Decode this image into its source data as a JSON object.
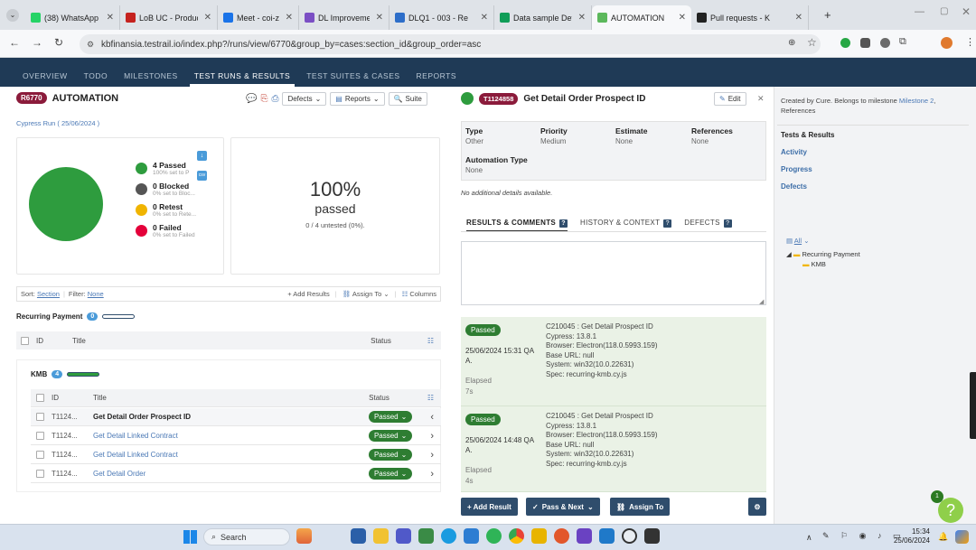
{
  "browser": {
    "tabs": [
      {
        "label": "(38) WhatsApp",
        "color": "#25d366"
      },
      {
        "label": "LoB UC - Produc",
        "color": "#c5221f"
      },
      {
        "label": "Meet - coi-z",
        "color": "#1a73e8"
      },
      {
        "label": "DL Improvement",
        "color": "#7b4fc4"
      },
      {
        "label": "DLQ1 - 003 - Re",
        "color": "#2d6ec9"
      },
      {
        "label": "Data sample Det",
        "color": "#0f9d58"
      },
      {
        "label": "AUTOMATION",
        "color": "#5cb85c"
      },
      {
        "label": "Pull requests - K",
        "color": "#222222"
      }
    ],
    "url": "kbfinansia.testrail.io/index.php?/runs/view/6770&group_by=cases:section_id&group_order=asc"
  },
  "nav": {
    "items": [
      "OVERVIEW",
      "TODO",
      "MILESTONES",
      "TEST RUNS & RESULTS",
      "TEST SUITES & CASES",
      "REPORTS"
    ],
    "active": "TEST RUNS & RESULTS"
  },
  "run": {
    "id": "R6770",
    "title": "AUTOMATION",
    "subtitle": "Cypress Run ( 25/06/2024 )",
    "defects_btn": "Defects",
    "reports_btn": "Reports",
    "suite_btn": "Suite"
  },
  "summary": {
    "legend": [
      {
        "title": "4 Passed",
        "sub": "100% set to P",
        "color": "#2e9c3e"
      },
      {
        "title": "0 Blocked",
        "sub": "0% set to Bloc...",
        "color": "#555555"
      },
      {
        "title": "0 Retest",
        "sub": "0% set to Rete...",
        "color": "#f0b400"
      },
      {
        "title": "0 Failed",
        "sub": "0% set to Failed",
        "color": "#e4003a"
      }
    ],
    "percent": "100%",
    "passed_label": "passed",
    "untested": "0 / 4 untested (0%)."
  },
  "toolbar": {
    "sort_label": "Sort:",
    "sort_value": "Section",
    "filter_label": "Filter:",
    "filter_value": "None",
    "add_results": "+ Add Results",
    "assign_to": "Assign To",
    "columns": "Columns"
  },
  "sections": {
    "parent": {
      "name": "Recurring Payment",
      "count": "0"
    },
    "child": {
      "name": "KMB",
      "count": "4"
    },
    "col_id": "ID",
    "col_title": "Title",
    "col_status": "Status"
  },
  "cases": [
    {
      "id": "T1124...",
      "title": "Get Detail Order Prospect ID",
      "status": "Passed",
      "selected": true
    },
    {
      "id": "T1124...",
      "title": "Get Detail Linked Contract",
      "status": "Passed",
      "selected": false
    },
    {
      "id": "T1124...",
      "title": "Get Detail Linked Contract",
      "status": "Passed",
      "selected": false
    },
    {
      "id": "T1124...",
      "title": "Get Detail Order",
      "status": "Passed",
      "selected": false
    }
  ],
  "detail": {
    "test_id": "T1124858",
    "title": "Get Detail Order Prospect ID",
    "edit": "Edit",
    "fields": [
      {
        "label": "Type",
        "value": "Other"
      },
      {
        "label": "Priority",
        "value": "Medium"
      },
      {
        "label": "Estimate",
        "value": "None"
      },
      {
        "label": "References",
        "value": "None"
      }
    ],
    "automation_label": "Automation Type",
    "automation_value": "None",
    "no_details": "No additional details available.",
    "tabs": [
      "RESULTS & COMMENTS",
      "HISTORY & CONTEXT",
      "DEFECTS"
    ],
    "results": [
      {
        "status": "Passed",
        "date": "25/06/2024 15:31 QA A.",
        "elapsed_label": "Elapsed",
        "elapsed": "7s",
        "lines": [
          "C210045 : Get Detail Prospect ID",
          "Cypress: 13.8.1",
          "Browser: Electron(118.0.5993.159)",
          "Base URL: null",
          "System: win32(10.0.22631)",
          "Spec: recurring-kmb.cy.js"
        ]
      },
      {
        "status": "Passed",
        "date": "25/06/2024 14:48 QA A.",
        "elapsed_label": "Elapsed",
        "elapsed": "4s",
        "lines": [
          "C210045 : Get Detail Prospect ID",
          "Cypress: 13.8.1",
          "Browser: Electron(118.0.5993.159)",
          "Base URL: null",
          "System: win32(10.0.22631)",
          "Spec: recurring-kmb.cy.js"
        ]
      }
    ],
    "add_result": "+ Add Result",
    "pass_next": "Pass & Next",
    "assign_to": "Assign To"
  },
  "side": {
    "created_by": "Created by Cure. Belongs to milestone",
    "milestone": "Milestone 2",
    "references": "References",
    "links": [
      "Tests & Results",
      "Activity",
      "Progress",
      "Defects"
    ],
    "tree_all": "All",
    "tree_parent": "Recurring Payment",
    "tree_child": "KMB"
  },
  "help": {
    "count": "1",
    "label": "?"
  },
  "taskbar": {
    "search": "Search",
    "time": "15:34",
    "date": "25/06/2024"
  }
}
